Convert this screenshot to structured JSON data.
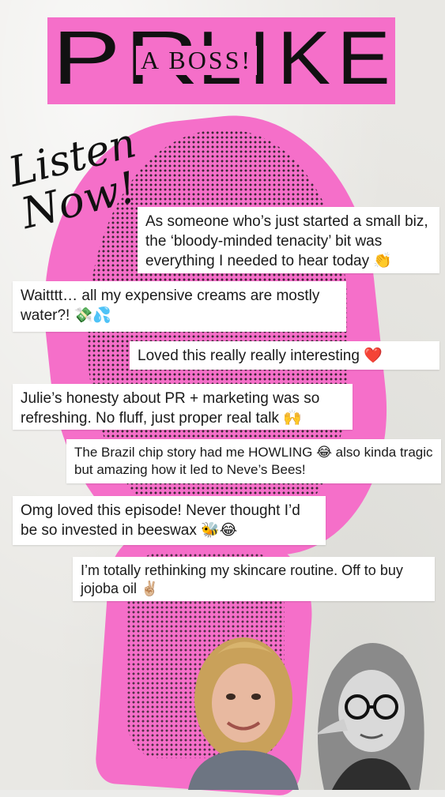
{
  "colors": {
    "accent_pink": "#f56fc9",
    "ink": "#111111",
    "card_bg": "#ffffff"
  },
  "title": {
    "line1_left": "PR",
    "line1_right": "LIKE",
    "overlay": "A BOSS!"
  },
  "callout": {
    "line1": "Listen",
    "line2": "Now!"
  },
  "comments": [
    {
      "text": "As someone who’s just started a small biz, the ‘bloody-minded tenacity’ bit was everything I needed to hear today",
      "emoji": "👏"
    },
    {
      "text": "Waitttt… all my expensive creams are mostly water?!",
      "emoji": "💸💦"
    },
    {
      "text": "Loved this really really interesting",
      "emoji": "❤️"
    },
    {
      "text": "Julie’s honesty about PR + marketing was so refreshing. No fluff, just proper real talk",
      "emoji": "🙌"
    },
    {
      "text": "The Brazil chip story had me HOWLING 😂 also kinda tragic but amazing how it led to Neve’s Bees!",
      "emoji": ""
    },
    {
      "text": "Omg loved this episode! Never thought I’d be so invested in beeswax",
      "emoji": "🐝😂"
    },
    {
      "text": "I’m totally rethinking my skincare routine. Off to buy jojoba oil",
      "emoji": "✌🏼"
    }
  ],
  "avatars": [
    {
      "icon": "person-photo-blonde-icon"
    },
    {
      "icon": "person-photo-glasses-icon"
    }
  ]
}
